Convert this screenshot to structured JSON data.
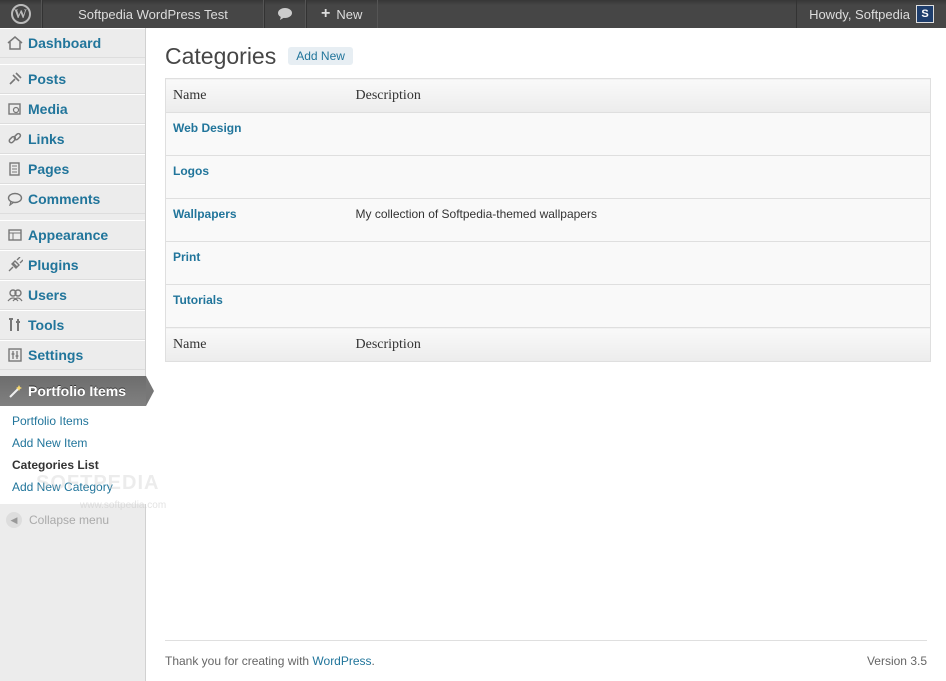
{
  "adminbar": {
    "site_name": "Softpedia WordPress Test",
    "new_label": "New",
    "howdy": "Howdy, Softpedia",
    "avatar_letter": "S"
  },
  "sidebar": {
    "items": [
      {
        "label": "Dashboard",
        "icon": "dashboard-icon"
      },
      {
        "label": "Posts",
        "icon": "pin-icon"
      },
      {
        "label": "Media",
        "icon": "media-icon"
      },
      {
        "label": "Links",
        "icon": "link-icon"
      },
      {
        "label": "Pages",
        "icon": "pages-icon"
      },
      {
        "label": "Comments",
        "icon": "comment-icon"
      },
      {
        "label": "Appearance",
        "icon": "appearance-icon"
      },
      {
        "label": "Plugins",
        "icon": "plugin-icon"
      },
      {
        "label": "Users",
        "icon": "users-icon"
      },
      {
        "label": "Tools",
        "icon": "tools-icon"
      },
      {
        "label": "Settings",
        "icon": "settings-icon"
      },
      {
        "label": "Portfolio Items",
        "icon": "wand-icon"
      }
    ],
    "submenu": [
      {
        "label": "Portfolio Items"
      },
      {
        "label": "Add New Item"
      },
      {
        "label": "Categories List",
        "active": true
      },
      {
        "label": "Add New Category"
      }
    ],
    "collapse_label": "Collapse menu"
  },
  "main": {
    "title": "Categories",
    "add_new_label": "Add New",
    "columns": [
      "Name",
      "Description"
    ],
    "rows": [
      {
        "name": "Web Design",
        "description": ""
      },
      {
        "name": "Logos",
        "description": ""
      },
      {
        "name": "Wallpapers",
        "description": "My collection of Softpedia-themed wallpapers"
      },
      {
        "name": "Print",
        "description": ""
      },
      {
        "name": "Tutorials",
        "description": ""
      }
    ]
  },
  "footer": {
    "thanks_text": "Thank you for creating with ",
    "wordpress_link": "WordPress",
    "thanks_suffix": ".",
    "version": "Version 3.5"
  },
  "watermark": {
    "text": "SOFTPEDIA",
    "sub": "www.softpedia.com"
  },
  "colors": {
    "link": "#21759b",
    "adminbar": "#464646",
    "current_menu": "#777777"
  }
}
